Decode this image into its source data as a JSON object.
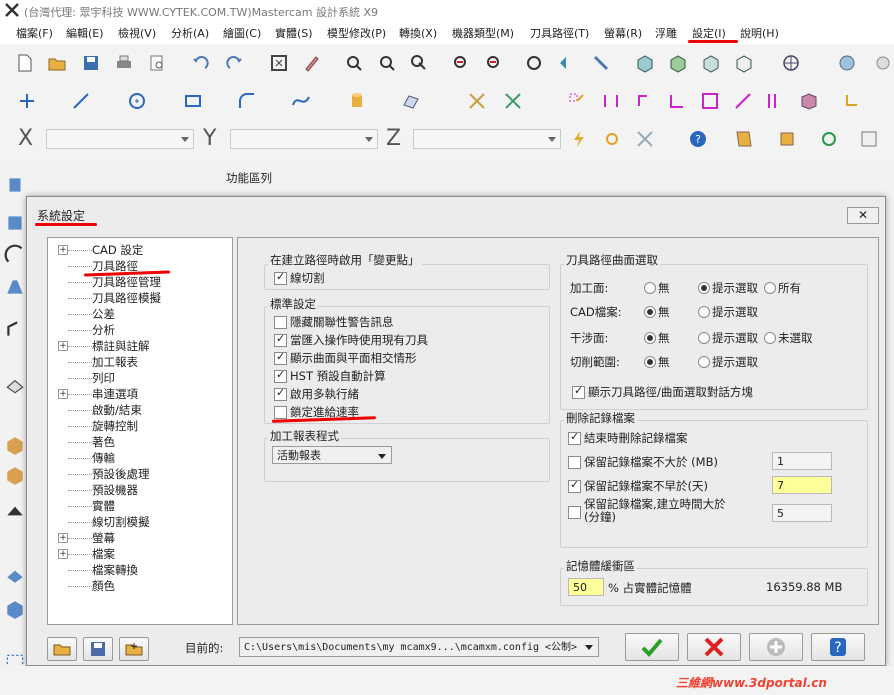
{
  "window": {
    "title": "(台灣代理: 眾宇科技 WWW.CYTEK.COM.TW)Mastercam 設計系統 X9"
  },
  "menu": [
    {
      "label": "檔案(F)"
    },
    {
      "label": "編輯(E)"
    },
    {
      "label": "檢視(V)"
    },
    {
      "label": "分析(A)"
    },
    {
      "label": "繪圖(C)"
    },
    {
      "label": "實體(S)"
    },
    {
      "label": "模型修改(P)"
    },
    {
      "label": "轉換(X)"
    },
    {
      "label": "機器類型(M)"
    },
    {
      "label": "刀具路徑(T)"
    },
    {
      "label": "螢幕(R)"
    },
    {
      "label": "浮雕"
    },
    {
      "label": "設定(I)"
    },
    {
      "label": "說明(H)"
    }
  ],
  "coords": {
    "x_label": "X",
    "y_label": "Y",
    "z_label": "Z"
  },
  "function_area_label": "功能區列",
  "dialog": {
    "title": "系統設定",
    "close_label": "✕",
    "tree": [
      {
        "label": "CAD 設定",
        "expandable": true
      },
      {
        "label": "刀具路徑",
        "expandable": false
      },
      {
        "label": "刀具路徑管理",
        "expandable": false
      },
      {
        "label": "刀具路徑模擬",
        "expandable": false
      },
      {
        "label": "公差",
        "expandable": false
      },
      {
        "label": "分析",
        "expandable": false
      },
      {
        "label": "標註與註解",
        "expandable": true
      },
      {
        "label": "加工報表",
        "expandable": false
      },
      {
        "label": "列印",
        "expandable": false
      },
      {
        "label": "串連選項",
        "expandable": true
      },
      {
        "label": "啟動/結束",
        "expandable": false
      },
      {
        "label": "旋轉控制",
        "expandable": false
      },
      {
        "label": "著色",
        "expandable": false
      },
      {
        "label": "傳輸",
        "expandable": false
      },
      {
        "label": "預設後處理",
        "expandable": false
      },
      {
        "label": "預設機器",
        "expandable": false
      },
      {
        "label": "實體",
        "expandable": false
      },
      {
        "label": "線切割模擬",
        "expandable": false
      },
      {
        "label": "螢幕",
        "expandable": true
      },
      {
        "label": "檔案",
        "expandable": true
      },
      {
        "label": "檔案轉換",
        "expandable": false
      },
      {
        "label": "顏色",
        "expandable": false
      }
    ],
    "change_point": {
      "title": "在建立路徑時啟用「變更點」",
      "items": [
        {
          "label": "線切割",
          "checked": true
        }
      ]
    },
    "standard": {
      "title": "標準設定",
      "items": [
        {
          "label": "隱藏關聯性警告訊息",
          "checked": false
        },
        {
          "label": "當匯入操作時使用現有刀具",
          "checked": true
        },
        {
          "label": "顯示曲面與平面相交情形",
          "checked": true
        },
        {
          "label": "HST 預設自動計算",
          "checked": true
        },
        {
          "label": "啟用多執行緒",
          "checked": true
        },
        {
          "label": "鎖定進給速率",
          "checked": false
        }
      ]
    },
    "report": {
      "title": "加工報表程式",
      "selected": "活動報表"
    },
    "surface_select": {
      "title": "刀具路徑曲面選取",
      "rows": [
        {
          "label": "加工面:",
          "options": [
            "無",
            "提示選取",
            "所有"
          ],
          "selected": 1
        },
        {
          "label": "CAD檔案:",
          "options": [
            "無",
            "提示選取"
          ],
          "selected": 0
        },
        {
          "label": "干涉面:",
          "options": [
            "無",
            "提示選取",
            "未選取"
          ],
          "selected": 0
        },
        {
          "label": "切削範圍:",
          "options": [
            "無",
            "提示選取"
          ],
          "selected": 0
        }
      ],
      "show_dialog": {
        "label": "顯示刀具路徑/曲面選取對話方塊",
        "checked": true
      }
    },
    "delete_log": {
      "title": "刪除記錄檔案",
      "items": [
        {
          "label": "結束時刪除記錄檔案",
          "checked": true,
          "value": null
        },
        {
          "label": "保留記錄檔案不大於 (MB)",
          "checked": false,
          "value": "1"
        },
        {
          "label": "保留記錄檔案不早於(天)",
          "checked": true,
          "value": "7"
        },
        {
          "label": "保留記錄檔案,建立時間大於(分鐘)",
          "checked": false,
          "value": "5"
        }
      ]
    },
    "memory": {
      "title": "記憶體緩衝區",
      "value": "50",
      "unit_label": "% 占實體記憶體",
      "total": "16359.88 MB"
    },
    "current_label": "目前的:",
    "current_path": "C:\\Users\\mis\\Documents\\my mcamx9...\\mcamxm.config <公制>"
  },
  "watermark": "三維網www.3dportal.cn",
  "colors": {
    "highlight": "#ffff99",
    "annotation": "#e00000",
    "ok_green": "#2aa02a",
    "cancel_red": "#e02020"
  }
}
